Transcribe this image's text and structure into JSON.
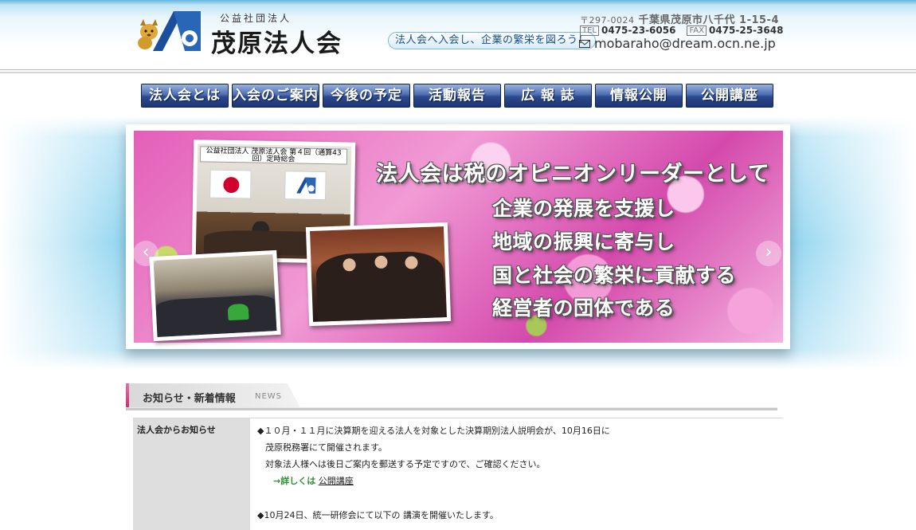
{
  "header": {
    "org_sub": "公益社団法人",
    "org_name": "茂原法人会",
    "slogan": "法人会へ入会し、企業の繁栄を図ろう！",
    "zip": "〒297-0024",
    "address": "千葉県茂原市八千代 1-15-4",
    "tel_tag": "TEL",
    "tel": "0475-23-6056",
    "fax_tag": "FAX",
    "fax": "0475-25-3648",
    "email": "mobaraho@dream.ocn.ne.jp"
  },
  "nav": [
    {
      "label": "法人会とは"
    },
    {
      "label": "入会のご案内"
    },
    {
      "label": "今後の予定"
    },
    {
      "label": "活動報告"
    },
    {
      "label": "広 報 誌"
    },
    {
      "label": "情報公開"
    },
    {
      "label": "公開講座"
    }
  ],
  "slider": {
    "headline": "法人会は税のオピニオンリーダーとして",
    "lines": [
      "企業の発展を支援し",
      "地域の振興に寄与し",
      "国と社会の繁栄に貢献する",
      "経営者の団体である"
    ],
    "banner_title": "公益社団法人 茂原法人会 第４回（通算43回）定時総会",
    "arrow_left": "‹",
    "arrow_right": "›"
  },
  "news": {
    "title": "お知らせ・新着情報",
    "subtitle": "NEWS",
    "row_label": "法人会からお知らせ",
    "item1_line1": "◆１０月・１１月に決算期を迎える法人を対象とした決算期別法人説明会が、10月16日に",
    "item1_line2": "茂原税務署にて開催されます。",
    "item1_line3": "対象法人様へは後日ご案内を郵送する予定ですので、ご確認ください。",
    "item1_link_prefix": "→詳しくは",
    "item1_link": "公開講座",
    "item2_line1": "◆10月24日、統一研修会にて以下の 講演を開催いたします。"
  },
  "colors": {
    "nav_blue": "#2c4a8f",
    "header_blue": "#5fb4df",
    "news_accent": "#c1306f",
    "link_green": "#2f8f2f"
  },
  "icons": [
    "mascot-icon",
    "org-logo-icon",
    "mail-icon",
    "chevron-left-icon",
    "chevron-right-icon"
  ]
}
